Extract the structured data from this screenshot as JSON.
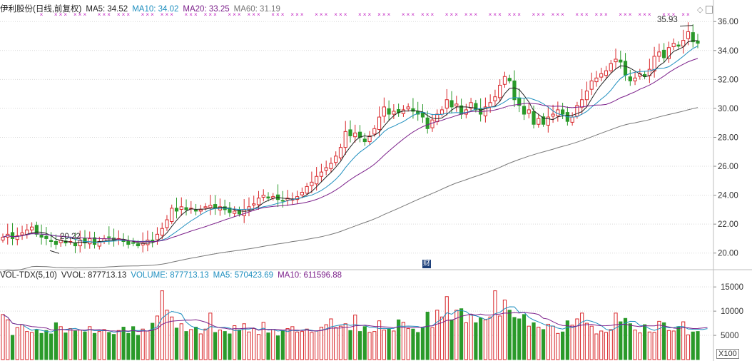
{
  "price_panel": {
    "title": "伊利股份(日线,前复权)",
    "ma_labels": [
      {
        "text": "MA5: 34.52",
        "color": "#222222"
      },
      {
        "text": "MA10: 34.02",
        "color": "#1f8fbf"
      },
      {
        "text": "MA20: 33.25",
        "color": "#7b1f8a"
      },
      {
        "text": "MA60: 31.19",
        "color": "#777777"
      }
    ],
    "max_label": "35.93",
    "min_label": "20.22",
    "badge": "财"
  },
  "volume_panel": {
    "legend": [
      {
        "text": "VOL-TDX(5,10)",
        "color": "#222222"
      },
      {
        "text": "VVOL: 877713.13",
        "color": "#222222"
      },
      {
        "text": "VOLUME: 877713.13",
        "color": "#1f8fbf"
      },
      {
        "text": "MA5: 570423.69",
        "color": "#1f8fbf"
      },
      {
        "text": "MA10: 611596.88",
        "color": "#7b1f8a"
      }
    ],
    "unit_label": "X100"
  },
  "colors": {
    "up": "#d8262a",
    "down": "#2a9a2a",
    "ma5": "#222222",
    "ma10": "#1f8fbf",
    "ma20": "#7b1f8a",
    "ma60": "#777777",
    "grid": "#d9d9d9",
    "marker": "#c020c0"
  },
  "chart_data": [
    {
      "type": "candlestick",
      "ylim": [
        19,
        36.8
      ],
      "y_ticks": [
        "36.00",
        "34.00",
        "32.00",
        "30.00",
        "28.00",
        "26.00",
        "24.00",
        "22.00",
        "20.00"
      ],
      "close": [
        21.1,
        21.3,
        21.0,
        21.2,
        21.4,
        21.6,
        21.8,
        21.3,
        21.1,
        21.0,
        20.8,
        20.6,
        20.9,
        20.7,
        20.8,
        20.5,
        20.9,
        20.7,
        21.0,
        20.6,
        20.8,
        21.0,
        21.1,
        20.9,
        21.0,
        20.8,
        20.6,
        20.7,
        20.5,
        20.7,
        20.9,
        20.8,
        21.3,
        21.7,
        22.3,
        23.1,
        22.9,
        23.2,
        23.0,
        23.1,
        22.9,
        23.0,
        23.2,
        23.3,
        23.1,
        23.2,
        23.0,
        22.8,
        22.9,
        22.7,
        23.0,
        23.2,
        23.4,
        23.8,
        24.0,
        23.8,
        23.9,
        23.7,
        23.6,
        23.8,
        23.7,
        23.9,
        24.2,
        24.6,
        24.9,
        25.3,
        25.6,
        25.9,
        26.2,
        26.7,
        27.3,
        28.4,
        28.1,
        28.3,
        28.0,
        27.7,
        28.1,
        28.6,
        29.4,
        30.1,
        29.6,
        29.8,
        29.7,
        29.9,
        30.1,
        29.8,
        29.6,
        29.4,
        28.6,
        29.2,
        29.6,
        29.9,
        30.6,
        30.1,
        30.3,
        29.6,
        29.9,
        30.4,
        29.9,
        29.6,
        30.1,
        30.4,
        30.8,
        31.6,
        32.2,
        31.9,
        30.6,
        30.2,
        29.6,
        29.9,
        28.9,
        29.3,
        28.9,
        29.4,
        29.6,
        29.9,
        29.6,
        29.1,
        29.4,
        30.2,
        30.6,
        31.2,
        31.9,
        32.1,
        32.4,
        32.6,
        33.1,
        33.4,
        33.2,
        32.3,
        31.9,
        32.1,
        32.4,
        32.2,
        32.7,
        33.6,
        33.9,
        33.5,
        34.2,
        34.5,
        34.3,
        34.7,
        35.3,
        34.6,
        34.5
      ],
      "series": [
        {
          "name": "MA5",
          "values_last": 34.52
        },
        {
          "name": "MA10",
          "values_last": 34.02
        },
        {
          "name": "MA20",
          "values_last": 33.25
        },
        {
          "name": "MA60",
          "values_last": 31.19
        }
      ],
      "annotations": [
        "35.93",
        "20.22"
      ]
    },
    {
      "type": "bar",
      "ylim": [
        0,
        16500
      ],
      "y_ticks": [
        "15000",
        "10000",
        "5000"
      ],
      "volume": [
        9300,
        8200,
        5000,
        6600,
        7200,
        5800,
        5600,
        6200,
        5400,
        6000,
        5300,
        7600,
        6800,
        5500,
        6400,
        5900,
        6100,
        5700,
        6800,
        5400,
        5800,
        6200,
        5600,
        5200,
        6000,
        6700,
        5400,
        6800,
        5000,
        6300,
        5900,
        7500,
        9000,
        14200,
        10200,
        8800,
        6500,
        7400,
        5800,
        6200,
        6700,
        5300,
        6300,
        9600,
        5600,
        6100,
        5800,
        5300,
        7000,
        6100,
        7400,
        5700,
        6400,
        5200,
        7700,
        5500,
        6200,
        4900,
        5900,
        6400,
        6800,
        5700,
        5800,
        6300,
        5600,
        5900,
        6700,
        7200,
        8400,
        6600,
        6900,
        7400,
        6000,
        9200,
        5800,
        6800,
        5600,
        5800,
        8000,
        6100,
        6400,
        5900,
        8200,
        7700,
        6400,
        6300,
        5600,
        6600,
        9800,
        6600,
        10200,
        8800,
        13000,
        8200,
        10200,
        10500,
        7600,
        9300,
        7600,
        8600,
        8200,
        8800,
        14200,
        9000,
        12300,
        10200,
        8700,
        8400,
        9300,
        6900,
        7600,
        6700,
        6200,
        7300,
        6900,
        5400,
        5700,
        8000,
        7100,
        8400,
        9600,
        7500,
        6900,
        5300,
        5900,
        5600,
        6200,
        9600,
        7800,
        8500,
        7400,
        6100,
        5500,
        7200,
        5700,
        5600,
        7900,
        7600,
        6000,
        5900,
        6800,
        7800,
        5100,
        5700,
        5800,
        6600,
        8800
      ],
      "vvol_last": 877713.13,
      "ma5_last": 570423.69,
      "ma10_last": 611596.88
    }
  ]
}
